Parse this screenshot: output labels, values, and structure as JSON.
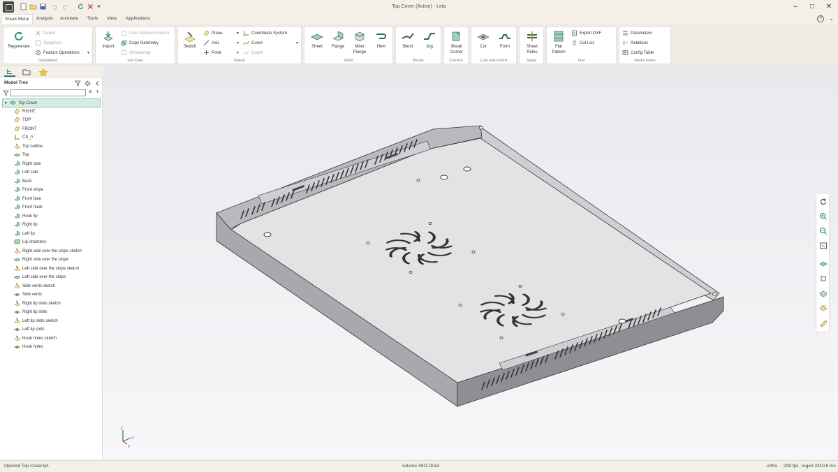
{
  "window": {
    "title": "Top Cover (Active) - Leta"
  },
  "menu_tabs": [
    {
      "label": "Sheet Metal",
      "active": true
    },
    {
      "label": "Analysis"
    },
    {
      "label": "Annotate"
    },
    {
      "label": "Tools"
    },
    {
      "label": "View"
    },
    {
      "label": "Applications"
    }
  ],
  "ribbon": {
    "operations": {
      "label": "Operations",
      "regenerate": "Regenerate",
      "delete": "Delete",
      "suppress": "Suppress",
      "feature_operations": "Feature Operations"
    },
    "get_data": {
      "label": "Get Data",
      "import": "Import",
      "user_defined_feature": "User Defined Feature",
      "copy_geometry": "Copy Geometry",
      "shrinkwrap": "Shrinkwrap"
    },
    "datum": {
      "label": "Datum",
      "sketch": "Sketch",
      "plane": "Plane",
      "axis": "Axis",
      "point": "Point",
      "coordinate_system": "Coordinate System",
      "curve": "Curve",
      "graph": "Graph"
    },
    "walls": {
      "label": "Walls",
      "sheet": "Sheet",
      "flange": "Flange",
      "miter_flange_1": "Miter",
      "miter_flange_2": "Flange",
      "hem": "Hem"
    },
    "bends": {
      "label": "Bends",
      "bend": "Bend",
      "jog": "Jog"
    },
    "corners": {
      "label": "Corners",
      "break_corner_1": "Break",
      "break_corner_2": "Corner"
    },
    "cuts_forms": {
      "label": "Cuts and Forms",
      "cut": "Cut",
      "form": "Form"
    },
    "setup": {
      "label": "Setup",
      "sheet_rules_1": "Sheet",
      "sheet_rules_2": "Rules"
    },
    "flat": {
      "label": "Flat",
      "flat_pattern_1": "Flat",
      "flat_pattern_2": "Pattern",
      "export_dxf": "Export DXF",
      "cut_list": "Cut List"
    },
    "model_intent": {
      "label": "Model Intent",
      "parameters": "Parameters",
      "relations": "Relations",
      "config_table": "Config Table"
    }
  },
  "model_tree": {
    "title": "Model Tree",
    "filter_value": "",
    "root": "Top Cover",
    "items": [
      {
        "label": "RIGHT",
        "icon": "datum-plane-icon"
      },
      {
        "label": "TOP",
        "icon": "datum-plane-icon"
      },
      {
        "label": "FRONT",
        "icon": "datum-plane-icon"
      },
      {
        "label": "CS_0",
        "icon": "coordinate-system-icon"
      },
      {
        "label": "Top outline",
        "icon": "sketch-icon"
      },
      {
        "label": "Top",
        "icon": "sheet-icon"
      },
      {
        "label": "Right side",
        "icon": "flange-icon"
      },
      {
        "label": "Left side",
        "icon": "flange-icon"
      },
      {
        "label": "Back",
        "icon": "flange-icon"
      },
      {
        "label": "Front slope",
        "icon": "flange-icon"
      },
      {
        "label": "Front face",
        "icon": "flange-icon"
      },
      {
        "label": "Front hook",
        "icon": "flange-icon"
      },
      {
        "label": "Hook lip",
        "icon": "flange-icon"
      },
      {
        "label": "Right lip",
        "icon": "flange-icon"
      },
      {
        "label": "Left lip",
        "icon": "flange-icon"
      },
      {
        "label": "Lip chamfers",
        "icon": "chamfer-icon"
      },
      {
        "label": "Right side over the slope sketch",
        "icon": "sketch-icon"
      },
      {
        "label": "Right side over the slope",
        "icon": "sheet-icon"
      },
      {
        "label": "Left side over the slope sketch",
        "icon": "sketch-icon"
      },
      {
        "label": "Left side over the slope",
        "icon": "sheet-icon"
      },
      {
        "label": "Side vents sketch",
        "icon": "sketch-icon"
      },
      {
        "label": "Side vents",
        "icon": "cut-icon"
      },
      {
        "label": "Right lip slots sketch",
        "icon": "sketch-icon"
      },
      {
        "label": "Right lip slots",
        "icon": "cut-icon"
      },
      {
        "label": "Left lip slots sketch",
        "icon": "sketch-icon"
      },
      {
        "label": "Left lip slots",
        "icon": "cut-icon"
      },
      {
        "label": "Hook holes sketch",
        "icon": "sketch-icon"
      },
      {
        "label": "Hook holes",
        "icon": "cut-icon"
      }
    ]
  },
  "status": {
    "message": "Opened Top Cover.lpt.",
    "volume": "volume 391178.62",
    "projection": "ortho",
    "fps": "209 fps",
    "regen": "regen 2410.6 ms"
  },
  "triad": {
    "z": "Z",
    "y": "Y",
    "x": "X"
  },
  "colors": {
    "accent": "#2e7d6b",
    "chrome": "#f4f0e8",
    "part_top": "#d9d9dc",
    "part_side": "#a6a6aa",
    "part_dark": "#8e8e93"
  }
}
